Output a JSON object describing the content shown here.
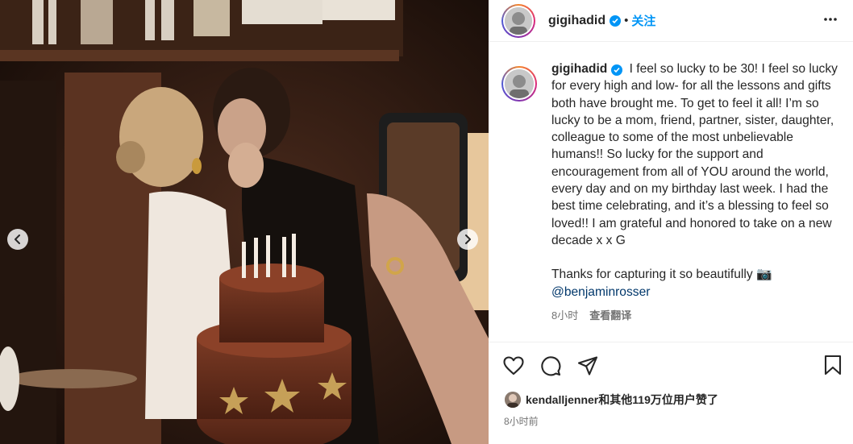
{
  "post": {
    "username": "gigihadid",
    "follow_label": "关注",
    "caption_lines": [
      "I feel so lucky to be 30! I feel so lucky for every high and low- for all the lessons and gifts both have brought me. To get to feel it all! I’m so lucky to be a mom, friend, partner, sister, daughter, colleague to some of the most unbelievable humans!! So lucky for the support and encouragement from all of YOU around the world, every day and on my birthday last week. I had the best time celebrating, and it’s a blessing to feel so loved!! I am grateful and honored to take on a new decade x x G"
    ],
    "thanks_line": "Thanks for capturing it so beautifully 📷",
    "mention": "@benjaminrosser",
    "caption_time": "8小时",
    "translate_label": "查看翻译",
    "liked_by_user": "kendalljenner",
    "liked_by_suffix": "和其他119万位用户赞了",
    "post_time": "8小时前"
  },
  "icons": {
    "verified": "verified-badge-icon",
    "more": "more-options-icon",
    "like": "heart-icon",
    "comment": "comment-icon",
    "share": "share-icon",
    "save": "bookmark-icon",
    "prev": "chevron-left-icon",
    "next": "chevron-right-icon",
    "camera": "camera-emoji"
  },
  "colors": {
    "accent": "#0095f6",
    "mention": "#00376b",
    "meta": "#737373",
    "text": "#262626"
  }
}
